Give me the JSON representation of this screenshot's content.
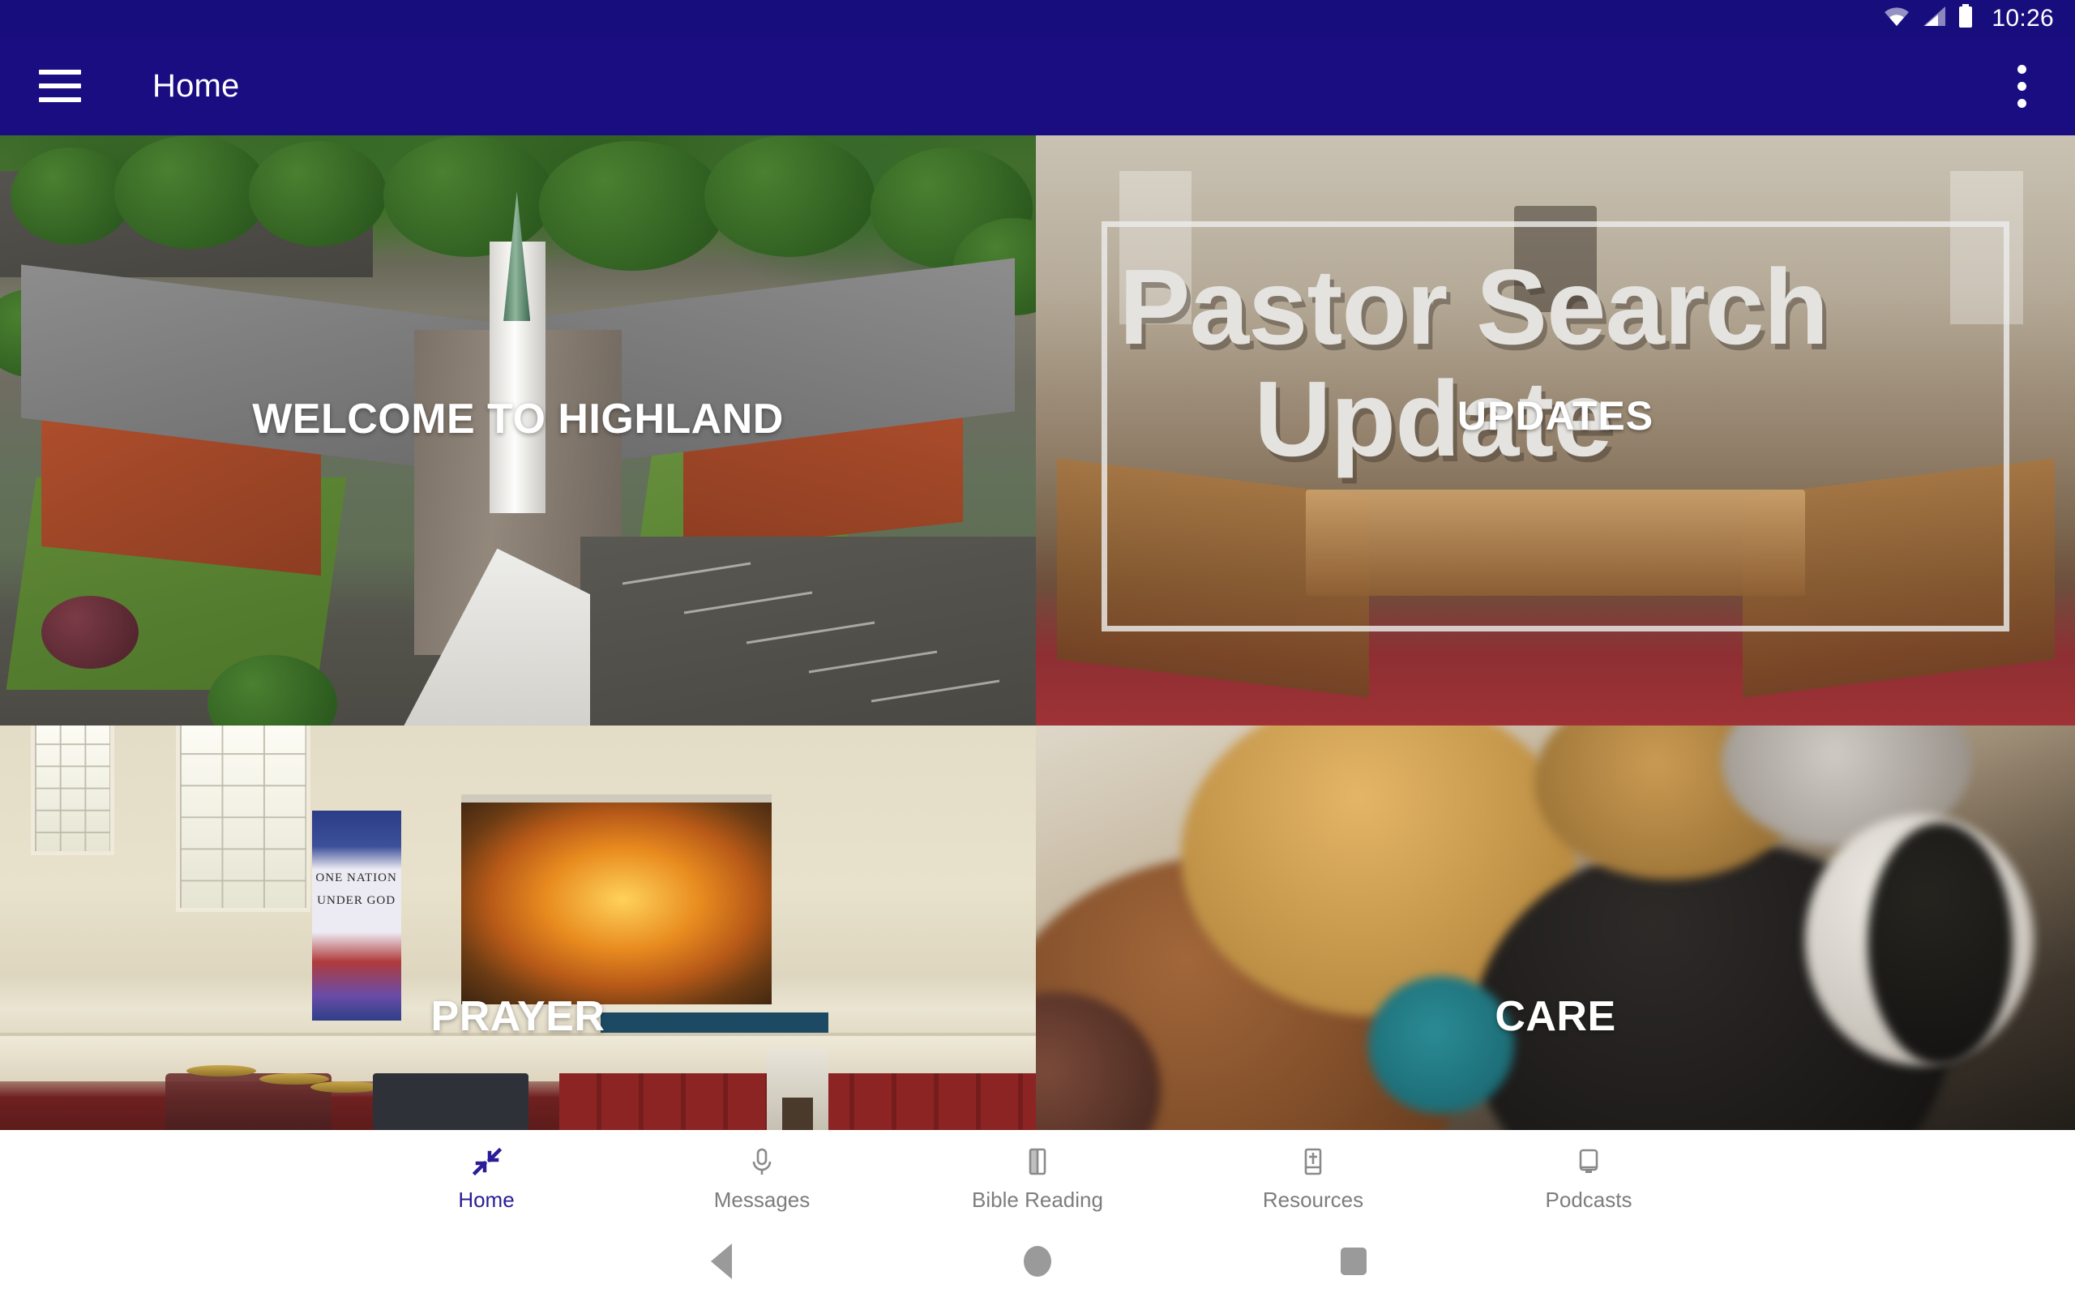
{
  "status_bar": {
    "time": "10:26",
    "icons": [
      "wifi-icon",
      "cell-signal-icon",
      "battery-icon"
    ]
  },
  "app_bar": {
    "title": "Home",
    "menu_icon": "hamburger-menu-icon",
    "overflow_icon": "overflow-menu-icon"
  },
  "tiles": [
    {
      "id": "welcome",
      "label": "WELCOME TO HIGHLAND",
      "image_description": "aerial-view-of-brick-church-campus-with-steeple"
    },
    {
      "id": "pastor-search",
      "label": "UPDATES",
      "graphic_line1": "Pastor Search",
      "graphic_line2": "Update",
      "image_description": "church-sanctuary-interior-with-wooden-pews-red-carpet"
    },
    {
      "id": "prayer",
      "label": "PRAYER",
      "banner_text": "ONE NATION UNDER GOD",
      "image_description": "sanctuary-platform-with-projection-screen-and-flag-banner"
    },
    {
      "id": "care",
      "label": "CARE",
      "image_description": "two-women-embracing-at-a-church-gathering"
    }
  ],
  "bottom_nav": {
    "active_color": "#2a1d96",
    "inactive_color": "#7d7d7d",
    "items": [
      {
        "label": "Home",
        "icon": "collapse-arrows-icon",
        "active": true
      },
      {
        "label": "Messages",
        "icon": "microphone-icon",
        "active": false
      },
      {
        "label": "Bible Reading",
        "icon": "open-book-icon",
        "active": false
      },
      {
        "label": "Resources",
        "icon": "bible-with-cross-icon",
        "active": false
      },
      {
        "label": "Podcasts",
        "icon": "monitor-icon",
        "active": false
      }
    ]
  },
  "system_nav": {
    "back": "back-triangle-icon",
    "home": "home-circle-icon",
    "recents": "recents-square-icon"
  },
  "colors": {
    "app_bar": "#1a0d82",
    "status_bar": "#180d7d",
    "nav_background": "#ffffff"
  }
}
